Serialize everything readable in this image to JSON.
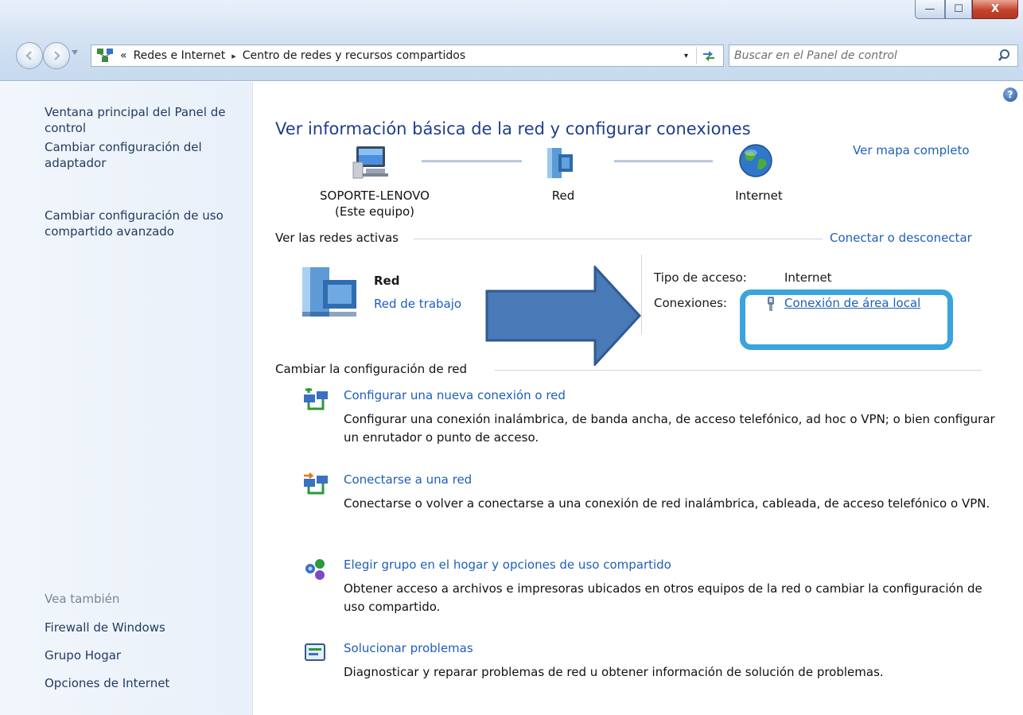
{
  "window": {
    "minimize_label": "—",
    "maximize_label": "☐",
    "close_label": "X"
  },
  "address_bar": {
    "overflow_chevron": "«",
    "breadcrumbs": [
      "Redes e Internet",
      "Centro de redes y recursos compartidos"
    ],
    "separator": "▸",
    "dropdown_glyph": "▾",
    "refresh_glyph": "↻"
  },
  "search": {
    "placeholder": "Buscar en el Panel de control"
  },
  "sidebar": {
    "tasks": [
      {
        "label": "Ventana principal del Panel de control"
      },
      {
        "label": "Cambiar configuración del adaptador"
      },
      {
        "label": "Cambiar configuración de uso compartido avanzado"
      }
    ],
    "see_also_heading": "Vea también",
    "see_also": [
      {
        "label": "Firewall de Windows"
      },
      {
        "label": "Grupo Hogar"
      },
      {
        "label": "Opciones de Internet"
      }
    ]
  },
  "main": {
    "help_glyph": "?",
    "title": "Ver información básica de la red y configurar conexiones",
    "view_full_map": "Ver mapa completo",
    "map": {
      "computer_name": "SOPORTE-LENOVO",
      "computer_note": "(Este equipo)",
      "network": "Red",
      "internet": "Internet"
    },
    "active_networks_heading": "Ver las redes activas",
    "connect_disconnect": "Conectar o desconectar",
    "active_network": {
      "name": "Red",
      "type": "Red de trabajo",
      "access_type_label": "Tipo de acceso:",
      "access_type_value": "Internet",
      "connections_label": "Conexiones:",
      "connection": "Conexión de área local"
    },
    "change_settings_heading": "Cambiar la configuración de red",
    "tasks": [
      {
        "icon": "new-connection-icon",
        "title": "Configurar una nueva conexión o red",
        "description": "Configurar una conexión inalámbrica, de banda ancha, de acceso telefónico, ad hoc o VPN; o bien configurar un enrutador o punto de acceso."
      },
      {
        "icon": "connect-network-icon",
        "title": "Conectarse a una red",
        "description": "Conectarse o volver a conectarse a una conexión de red inalámbrica, cableada, de acceso telefónico o VPN."
      },
      {
        "icon": "homegroup-icon",
        "title": "Elegir grupo en el hogar y opciones de uso compartido",
        "description": "Obtener acceso a archivos e impresoras ubicados en otros equipos de la red o cambiar la configuración de uso compartido."
      },
      {
        "icon": "troubleshoot-icon",
        "title": "Solucionar problemas",
        "description": "Diagnosticar y reparar problemas de red u obtener información de solución de problemas."
      }
    ]
  },
  "colors": {
    "link": "#1e5fb8",
    "title": "#1e3f8a",
    "highlight": "#39a4dd",
    "arrow": "#4a79b7"
  }
}
